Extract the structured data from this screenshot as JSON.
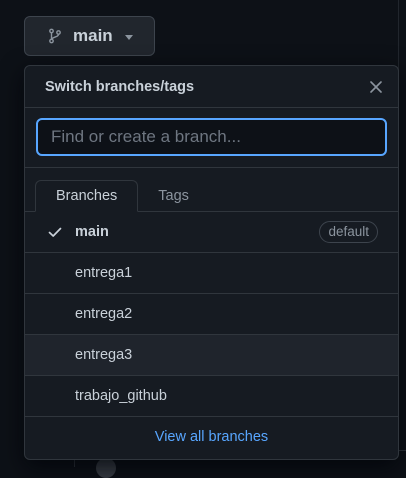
{
  "branch_button": {
    "label": "main",
    "icon": "git-branch-icon"
  },
  "dropdown": {
    "title": "Switch branches/tags",
    "close_icon": "close-icon",
    "filter": {
      "placeholder": "Find or create a branch...",
      "value": ""
    },
    "tabs": [
      {
        "label": "Branches",
        "active": true
      },
      {
        "label": "Tags",
        "active": false
      }
    ],
    "branches": [
      {
        "name": "main",
        "selected": true,
        "badge": "default"
      },
      {
        "name": "entrega1",
        "selected": false
      },
      {
        "name": "entrega2",
        "selected": false
      },
      {
        "name": "entrega3",
        "selected": false,
        "hovered": true
      },
      {
        "name": "trabajo_github",
        "selected": false
      }
    ],
    "footer_link": "View all branches"
  },
  "colors": {
    "accent": "#58a6ff",
    "background": "#0d1117",
    "panel": "#161b22",
    "border": "#30363d",
    "text": "#c9d1d9",
    "muted": "#8b949e"
  }
}
